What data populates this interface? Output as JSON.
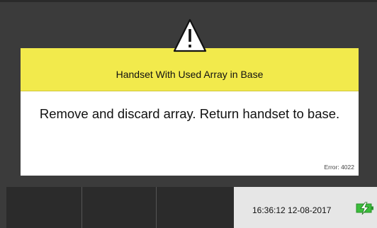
{
  "dialog": {
    "title": "Handset With Used Array in Base",
    "message": "Remove and discard array. Return handset to base.",
    "error_code": "Error: 4022",
    "icon": "warning-triangle-icon",
    "header_color": "#f2ea4c"
  },
  "footer": {
    "softkeys": [
      "",
      "",
      ""
    ],
    "datetime": "16:36:12  12-08-2017",
    "status_icon": "battery-charging-icon",
    "status_icon_color": "#3bbd3b"
  }
}
